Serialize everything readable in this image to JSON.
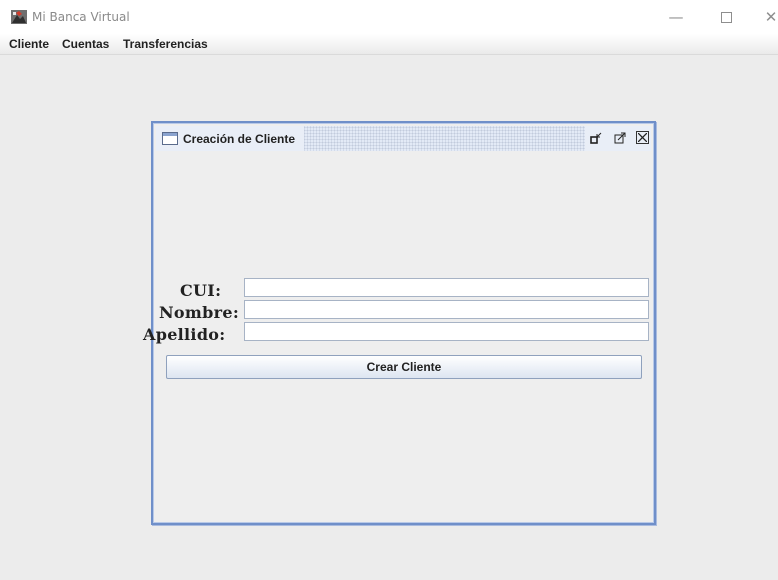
{
  "window": {
    "title": "Mi Banca Virtual",
    "controls": {
      "minimize": "—",
      "close": "✕"
    }
  },
  "menu": {
    "items": [
      "Cliente",
      "Cuentas",
      "Transferencias"
    ]
  },
  "internal_frame": {
    "title": "Creación de Cliente",
    "controls": {
      "iconify": "⌐",
      "maximize": "⤢",
      "close": "✕"
    }
  },
  "form": {
    "cui_label": "CUI:",
    "nombre_label": "Nombre:",
    "apellido_label": "Apellido:",
    "cui_value": "",
    "nombre_value": "",
    "apellido_value": "",
    "submit_label": "Crear Cliente"
  },
  "colors": {
    "frame_border": "#6f8fc9",
    "background": "#ececec"
  }
}
